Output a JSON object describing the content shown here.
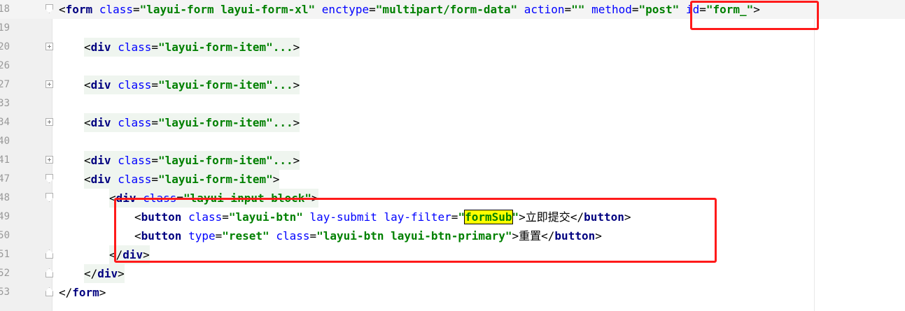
{
  "editor": {
    "lines": [
      {
        "num": "18",
        "fold": "start",
        "indent": 0,
        "html": "form_open"
      },
      {
        "num": "19",
        "fold": "none"
      },
      {
        "num": "20",
        "fold": "plus",
        "indent": 1,
        "html": "div_collapsed"
      },
      {
        "num": "26",
        "fold": "none"
      },
      {
        "num": "27",
        "fold": "plus",
        "indent": 1,
        "html": "div_collapsed"
      },
      {
        "num": "33",
        "fold": "none"
      },
      {
        "num": "34",
        "fold": "plus",
        "indent": 1,
        "html": "div_collapsed"
      },
      {
        "num": "40",
        "fold": "none"
      },
      {
        "num": "41",
        "fold": "plus",
        "indent": 1,
        "html": "div_collapsed"
      },
      {
        "num": "47",
        "fold": "start",
        "indent": 1,
        "html": "div_open"
      },
      {
        "num": "48",
        "fold": "start",
        "indent": 2,
        "html": "inner_div_open"
      },
      {
        "num": "49",
        "fold": "none",
        "indent": 3,
        "html": "button_submit"
      },
      {
        "num": "50",
        "fold": "none",
        "indent": 3,
        "html": "button_reset"
      },
      {
        "num": "51",
        "fold": "end",
        "indent": 2,
        "html": "inner_div_close"
      },
      {
        "num": "52",
        "fold": "end",
        "indent": 1,
        "html": "div_close"
      },
      {
        "num": "53",
        "fold": "end",
        "indent": 0,
        "html": "form_close"
      }
    ],
    "tokens": {
      "tag_form": "form",
      "tag_div": "div",
      "tag_button": "button",
      "attr_class": "class",
      "attr_enctype": "enctype",
      "attr_action": "action",
      "attr_method": "method",
      "attr_id": "id",
      "attr_type": "type",
      "attr_lay_submit": "lay-submit",
      "attr_lay_filter": "lay-filter",
      "val_form_class": "\"layui-form layui-form-xl\"",
      "val_enctype": "\"multipart/form-data\"",
      "val_action": "\"\"",
      "val_method": "\"post\"",
      "val_id": "\"form_\"",
      "val_item_collapsed": "\"layui-form-item\"...",
      "val_item": "\"layui-form-item\"",
      "val_input_block": "\"layui-input-block\"",
      "val_btn": "\"layui-btn\"",
      "val_filter_open": "\"",
      "val_filter_word": "formSub",
      "val_filter_close": "\"",
      "val_reset": "\"reset\"",
      "val_btn_primary": "\"layui-btn layui-btn-primary\"",
      "text_submit": "立即提交",
      "text_reset": "重置"
    }
  },
  "colors": {
    "annotation_red": "#ff1a1a",
    "search_highlight": "#ffff00"
  }
}
